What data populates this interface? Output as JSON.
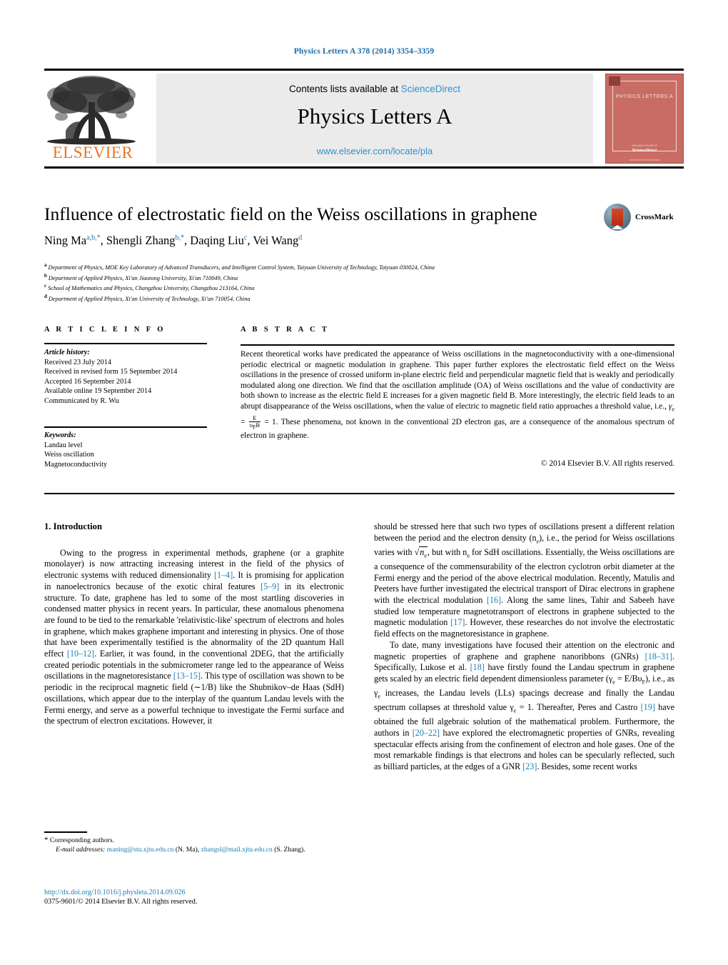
{
  "running_head": "Physics Letters A 378 (2014) 3354–3359",
  "masthead": {
    "contents_prefix": "Contents lists available at ",
    "sciencedirect": "ScienceDirect",
    "journal_title": "Physics Letters A",
    "journal_url": "www.elsevier.com/locate/pla",
    "publisher": "ELSEVIER",
    "cover": {
      "name": "PHYSICS LETTERS A",
      "foot1": "AVAILABLE ONLINE AT",
      "foot2": "ScienceDirect",
      "foot3": "www.elsevier.com/locate/pla"
    }
  },
  "article": {
    "title": "Influence of electrostatic field on the Weiss oscillations in graphene",
    "crossmark_label": "CrossMark",
    "authors": [
      {
        "name": "Ning Ma",
        "marks": "a,b,*"
      },
      {
        "name": "Shengli Zhang",
        "marks": "b,*"
      },
      {
        "name": "Daqing Liu",
        "marks": "c"
      },
      {
        "name": "Vei Wang",
        "marks": "d"
      }
    ],
    "affiliations": [
      {
        "mark": "a",
        "text": "Department of Physics, MOE Key Laboratory of Advanced Transducers, and Intelligent Control System, Taiyuan University of Technology, Taiyuan 030024, China"
      },
      {
        "mark": "b",
        "text": "Department of Applied Physics, Xi'an Jiaotong University, Xi'an 710049, China"
      },
      {
        "mark": "c",
        "text": "School of Mathematics and Physics, Changzhou University, Changzhou 213164, China"
      },
      {
        "mark": "d",
        "text": "Department of Applied Physics, Xi'an University of Technology, Xi'an 710054, China"
      }
    ]
  },
  "info": {
    "heading": "A R T I C L E   I N F O",
    "history_label": "Article history:",
    "history": [
      "Received 23 July 2014",
      "Received in revised form 15 September 2014",
      "Accepted 16 September 2014",
      "Available online 19 September 2014",
      "Communicated by R. Wu"
    ],
    "keywords_label": "Keywords:",
    "keywords": [
      "Landau level",
      "Weiss oscillation",
      "Magnetoconductivity"
    ]
  },
  "abstract": {
    "heading": "A B S T R A C T",
    "part1": "Recent theoretical works have predicated the appearance of Weiss oscillations in the magnetoconductivity with a one-dimensional periodic electrical or magnetic modulation in graphene. This paper further explores the electrostatic field effect on the Weiss oscillations in the presence of crossed uniform in-plane electric field and perpendicular magnetic field that is weakly and periodically modulated along one direction. We find that the oscillation amplitude (OA) of Weiss oscillations and the value of conductivity are both shown to increase as the electric field E increases for a given magnetic field B. More interestingly, the electric field leads to an abrupt disappearance of the Weiss oscillations, when the value of electric to magnetic field ratio approaches a threshold value, i.e., ",
    "formula_gamma": "γ",
    "formula_sub": "e",
    "formula_eq": " = ",
    "formula_num": "E",
    "formula_den": "υ",
    "formula_den_sub": "F",
    "formula_den_tail": "B",
    "formula_tail": " = 1.",
    "part2": " These phenomena, not known in the conventional 2D electron gas, are a consequence of the anomalous spectrum of electron in graphene.",
    "copyright": "© 2014 Elsevier B.V. All rights reserved."
  },
  "body": {
    "section_heading": "1. Introduction",
    "left": {
      "p1_a": "Owing to the progress in experimental methods, graphene (or a graphite monolayer) is now attracting increasing interest in the field of the physics of electronic systems with reduced dimensionality ",
      "p1_r1": "[1–4]",
      "p1_b": ". It is promising for application in nanoelectronics because of the exotic chiral features ",
      "p1_r2": "[5–9]",
      "p1_c": " in its electronic structure. To date, graphene has led to some of the most startling discoveries in condensed matter physics in recent years. In particular, these anomalous phenomena are found to be tied to the remarkable 'relativistic-like' spectrum of electrons and holes in graphene, which makes graphene important and interesting in physics. One of those that have been experimentally testified is the abnormality of the 2D quantum Hall effect ",
      "p1_r3": "[10–12]",
      "p1_d": ". Earlier, it was found, in the conventional 2DEG, that the artificially created periodic potentials in the submicrometer range led to the appearance of Weiss oscillations in the magnetoresistance ",
      "p1_r4": "[13–15]",
      "p1_e": ". This type of oscillation was shown to be periodic in the reciprocal magnetic field (∼1/B) like the Shubnikov–de Haas (SdH) oscillations, which appear due to the interplay of the quantum Landau levels with the Fermi energy, and serve as a powerful technique to investigate the Fermi surface and the spectrum of electron excitations. However, it"
    },
    "right": {
      "p1_a": "should be stressed here that such two types of oscillations present a different relation between the period and the electron density (n",
      "p1_sub1": "e",
      "p1_b": "), i.e., the period for Weiss oscillations varies with ",
      "p1_sqrt": "n",
      "p1_sqrt_sub": "e",
      "p1_c": ", but with n",
      "p1_sub2": "e",
      "p1_d": " for SdH oscillations. Essentially, the Weiss oscillations are a consequence of the commensurability of the electron cyclotron orbit diameter at the Fermi energy and the period of the above electrical modulation. Recently, Matulis and Peeters have further investigated the electrical transport of Dirac electrons in graphene with the electrical modulation ",
      "p1_r1": "[16]",
      "p1_e": ". Along the same lines, Tahir and Sabeeh have studied low temperature magnetotransport of electrons in graphene subjected to the magnetic modulation ",
      "p1_r2": "[17]",
      "p1_f": ". However, these researches do not involve the electrostatic field effects on the magnetoresistance in graphene.",
      "p2_a": "To date, many investigations have focused their attention on the electronic and magnetic properties of graphene and graphene nanoribbons (GNRs) ",
      "p2_r1": "[18–31]",
      "p2_b": ". Specifically, Lukose et al. ",
      "p2_r2": "[18]",
      "p2_c": " have firstly found the Landau spectrum in graphene gets scaled by an electric field dependent dimensionless parameter (γ",
      "p2_sub1": "e",
      "p2_d": " = E/Bυ",
      "p2_sub2": "F",
      "p2_e": "), i.e., as γ",
      "p2_sub3": "e",
      "p2_f": " increases, the Landau levels (LLs) spacings decrease and finally the Landau spectrum collapses at threshold value γ",
      "p2_sub4": "e",
      "p2_g": " = 1. Thereafter, Peres and Castro ",
      "p2_r3": "[19]",
      "p2_h": " have obtained the full algebraic solution of the mathematical problem. Furthermore, the authors in ",
      "p2_r4": "[20–22]",
      "p2_i": " have explored the electromagnetic properties of GNRs, revealing spectacular effects arising from the confinement of electron and hole gases. One of the most remarkable findings is that electrons and holes can be specularly reflected, such as billiard particles, at the edges of a GNR ",
      "p2_r5": "[23]",
      "p2_j": ". Besides, some recent works"
    }
  },
  "footnote": {
    "star": "*",
    "corresponding": "Corresponding authors.",
    "email_label": "E-mail addresses:",
    "email1": "maning@stu.xjtu.edu.cn",
    "email1_who": "(N. Ma),",
    "email2": "zhangsl@mail.xjtu.edu.cn",
    "email2_who": "(S. Zhang)."
  },
  "doi_block": {
    "doi": "http://dx.doi.org/10.1016/j.physleta.2014.09.026",
    "issn_line": "0375-9601/© 2014 Elsevier B.V. All rights reserved."
  },
  "colors": {
    "link_blue": "#1a7fb5",
    "sciencedirect_blue": "#2e8fd0",
    "elsevier_orange": "#E87722",
    "cover_red": "#c96d64"
  }
}
